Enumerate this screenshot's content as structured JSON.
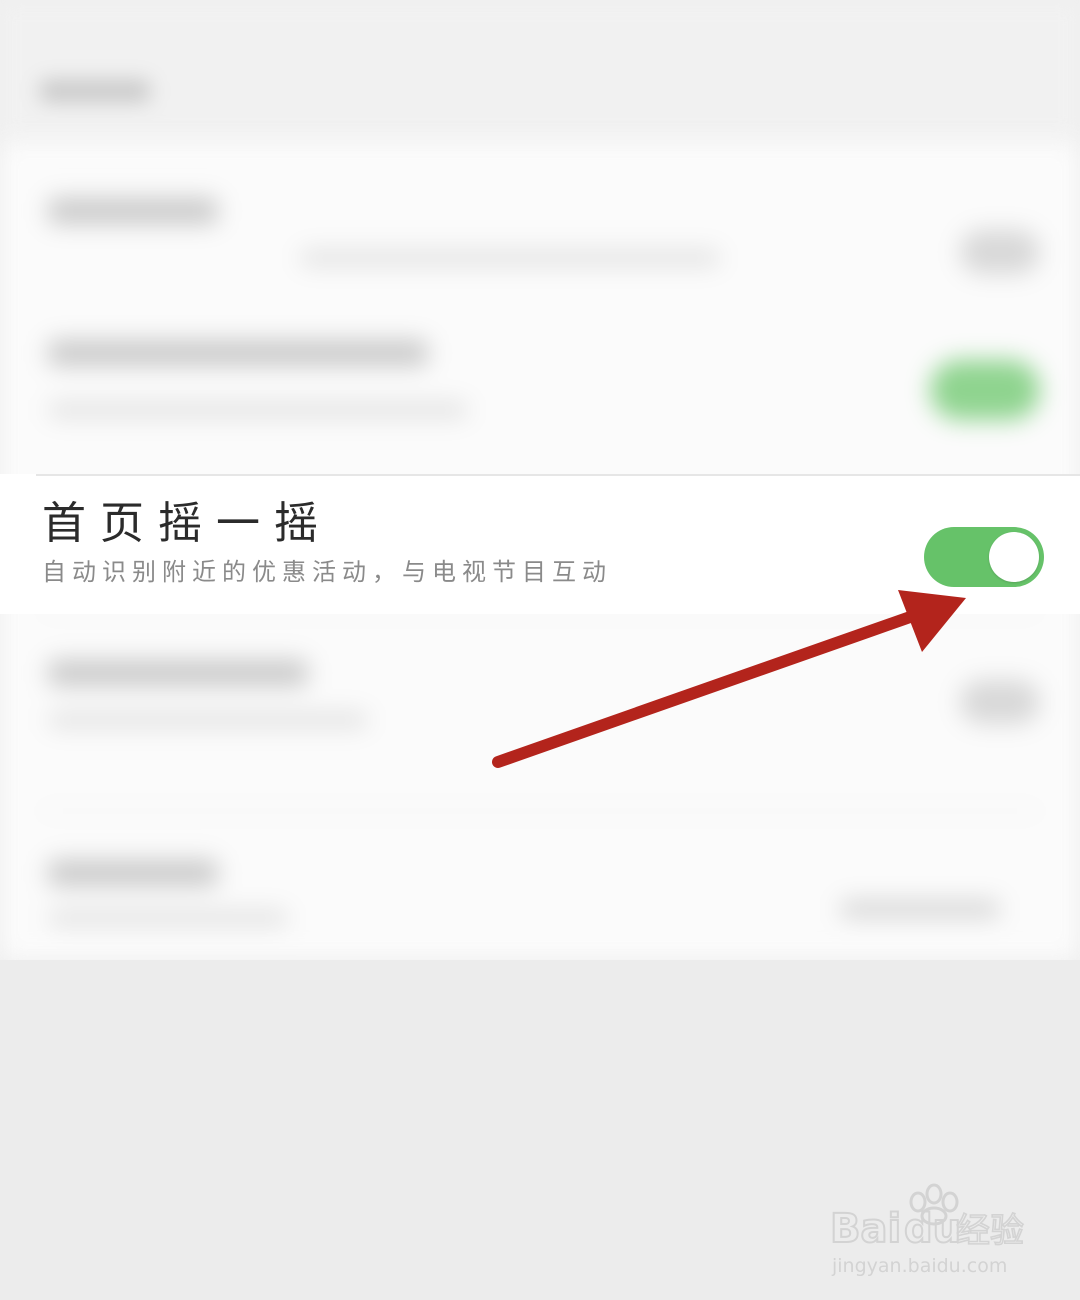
{
  "setting_row": {
    "title": "首页摇一摇",
    "subtitle": "自动识别附近的优惠活动，与电视节目互动",
    "toggle_state": "on"
  },
  "colors": {
    "toggle_on": "#66c269",
    "arrow": "#b3241c"
  },
  "watermark": {
    "brand_a": "Bai",
    "brand_b": "du",
    "brand_cn": "经验",
    "url": "jingyan.baidu.com"
  }
}
